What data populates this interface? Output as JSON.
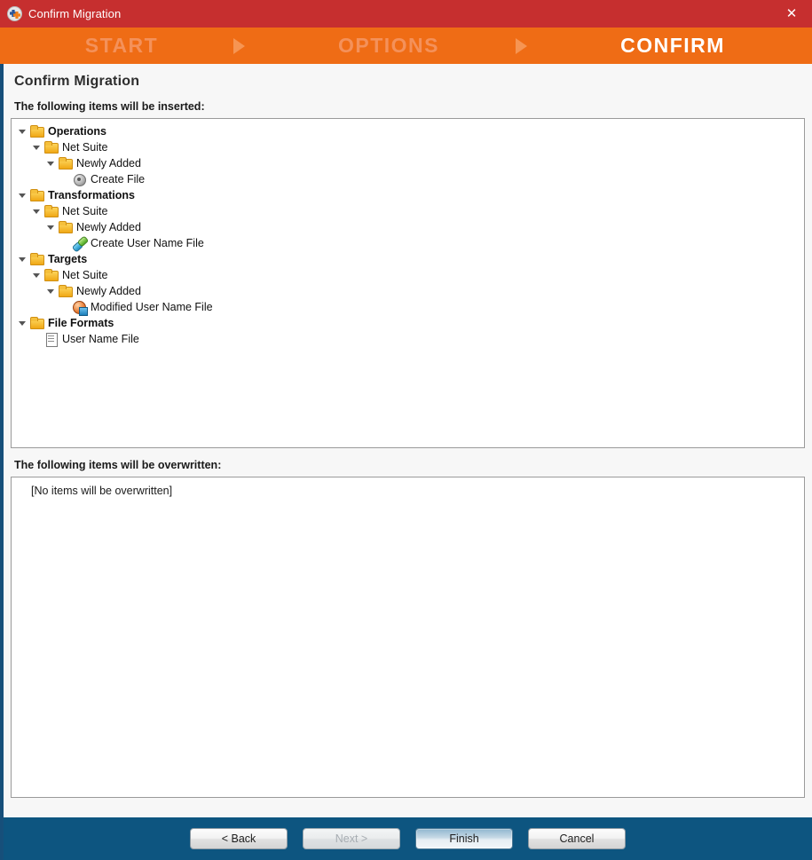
{
  "window": {
    "title": "Confirm Migration",
    "app_icon": "migration-app-icon",
    "close_label": "✕"
  },
  "steps": [
    {
      "label": "START",
      "state": "inactive"
    },
    {
      "label": "OPTIONS",
      "state": "inactive"
    },
    {
      "label": "CONFIRM",
      "state": "active"
    }
  ],
  "page": {
    "title": "Confirm Migration",
    "insert_label": "The following items will be inserted:",
    "overwrite_label": "The following items will be overwritten:",
    "overwrite_empty_text": "[No items will be overwritten]"
  },
  "tree": [
    {
      "label": "Operations",
      "depth": 0,
      "icon": "folder",
      "bold": true,
      "expanded": true
    },
    {
      "label": "Net Suite",
      "depth": 1,
      "icon": "folder",
      "bold": false,
      "expanded": true
    },
    {
      "label": "Newly Added",
      "depth": 2,
      "icon": "folder",
      "bold": false,
      "expanded": true
    },
    {
      "label": "Create File",
      "depth": 3,
      "icon": "operation",
      "bold": false,
      "expanded": null
    },
    {
      "label": "Transformations",
      "depth": 0,
      "icon": "folder",
      "bold": true,
      "expanded": true
    },
    {
      "label": "Net Suite",
      "depth": 1,
      "icon": "folder",
      "bold": false,
      "expanded": true
    },
    {
      "label": "Newly Added",
      "depth": 2,
      "icon": "folder",
      "bold": false,
      "expanded": true
    },
    {
      "label": "Create User Name File",
      "depth": 3,
      "icon": "transform",
      "bold": false,
      "expanded": null
    },
    {
      "label": "Targets",
      "depth": 0,
      "icon": "folder",
      "bold": true,
      "expanded": true
    },
    {
      "label": "Net Suite",
      "depth": 1,
      "icon": "folder",
      "bold": false,
      "expanded": true
    },
    {
      "label": "Newly Added",
      "depth": 2,
      "icon": "folder",
      "bold": false,
      "expanded": true
    },
    {
      "label": "Modified User Name File",
      "depth": 3,
      "icon": "target",
      "bold": false,
      "expanded": null
    },
    {
      "label": "File Formats",
      "depth": 0,
      "icon": "folder",
      "bold": true,
      "expanded": true
    },
    {
      "label": "User Name File",
      "depth": 1,
      "icon": "doc",
      "bold": false,
      "expanded": null
    }
  ],
  "buttons": [
    {
      "label": "< Back",
      "state": "enabled"
    },
    {
      "label": "Next >",
      "state": "disabled"
    },
    {
      "label": "Finish",
      "state": "primary"
    },
    {
      "label": "Cancel",
      "state": "enabled"
    }
  ],
  "colors": {
    "titlebar": "#c62f2f",
    "steps_bar": "#ef6c15",
    "step_inactive": "#f4915a",
    "step_active": "#ffffff",
    "footer": "#0d5580",
    "content_bg": "#f7f7f7",
    "panel_bg": "#ffffff"
  }
}
